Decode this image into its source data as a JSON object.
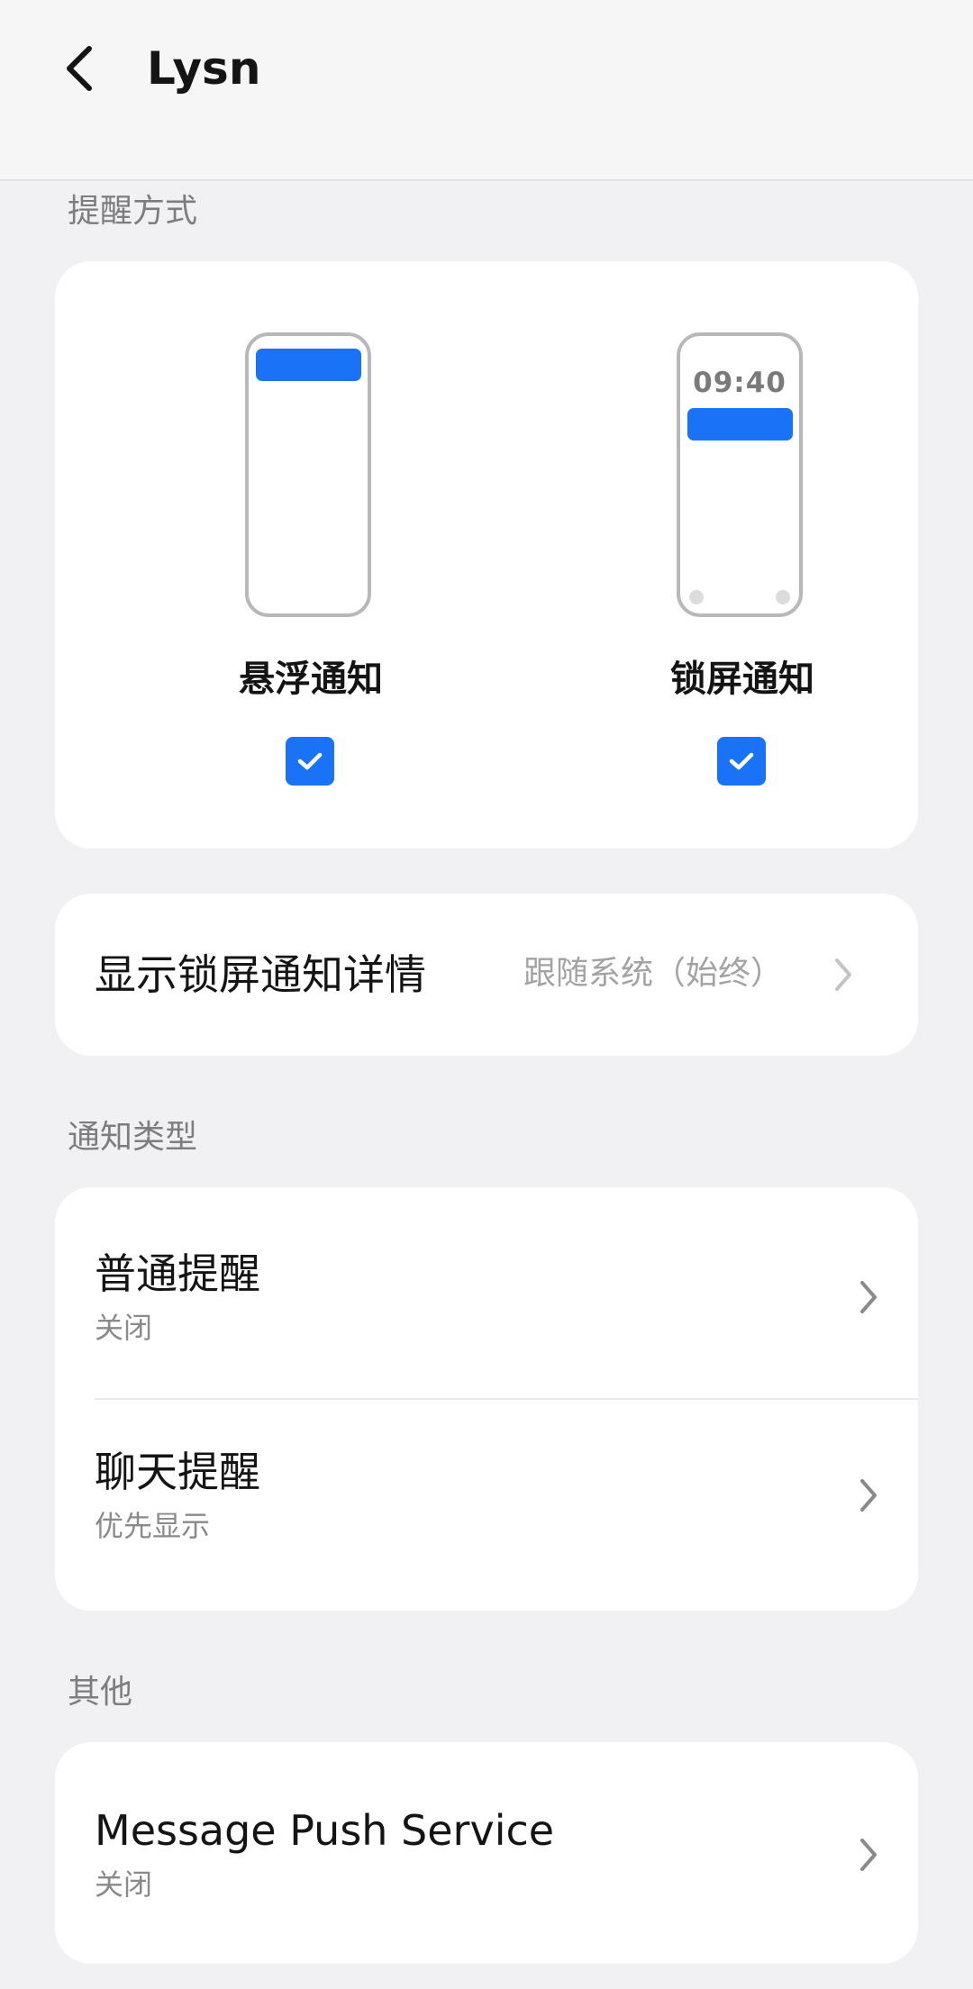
{
  "header": {
    "back_icon": "back-arrow-icon",
    "title": "Lysn"
  },
  "alert_method": {
    "section_label": "提醒方式",
    "options": [
      {
        "label": "悬浮通知",
        "checked": true
      },
      {
        "label": "锁屏通知",
        "checked": true,
        "preview_time": "09:40"
      }
    ]
  },
  "lockscreen_details": {
    "title": "显示锁屏通知详情",
    "value": "跟随系统（始终）"
  },
  "notification_types": {
    "section_label": "通知类型",
    "items": [
      {
        "title": "普通提醒",
        "subtitle": "关闭"
      },
      {
        "title": "聊天提醒",
        "subtitle": "优先显示"
      }
    ]
  },
  "other": {
    "section_label": "其他",
    "items": [
      {
        "title": "Message Push Service",
        "subtitle": "关闭"
      }
    ]
  },
  "colors": {
    "accent": "#1a73f6",
    "background": "#f1f1f3",
    "card": "#ffffff"
  }
}
